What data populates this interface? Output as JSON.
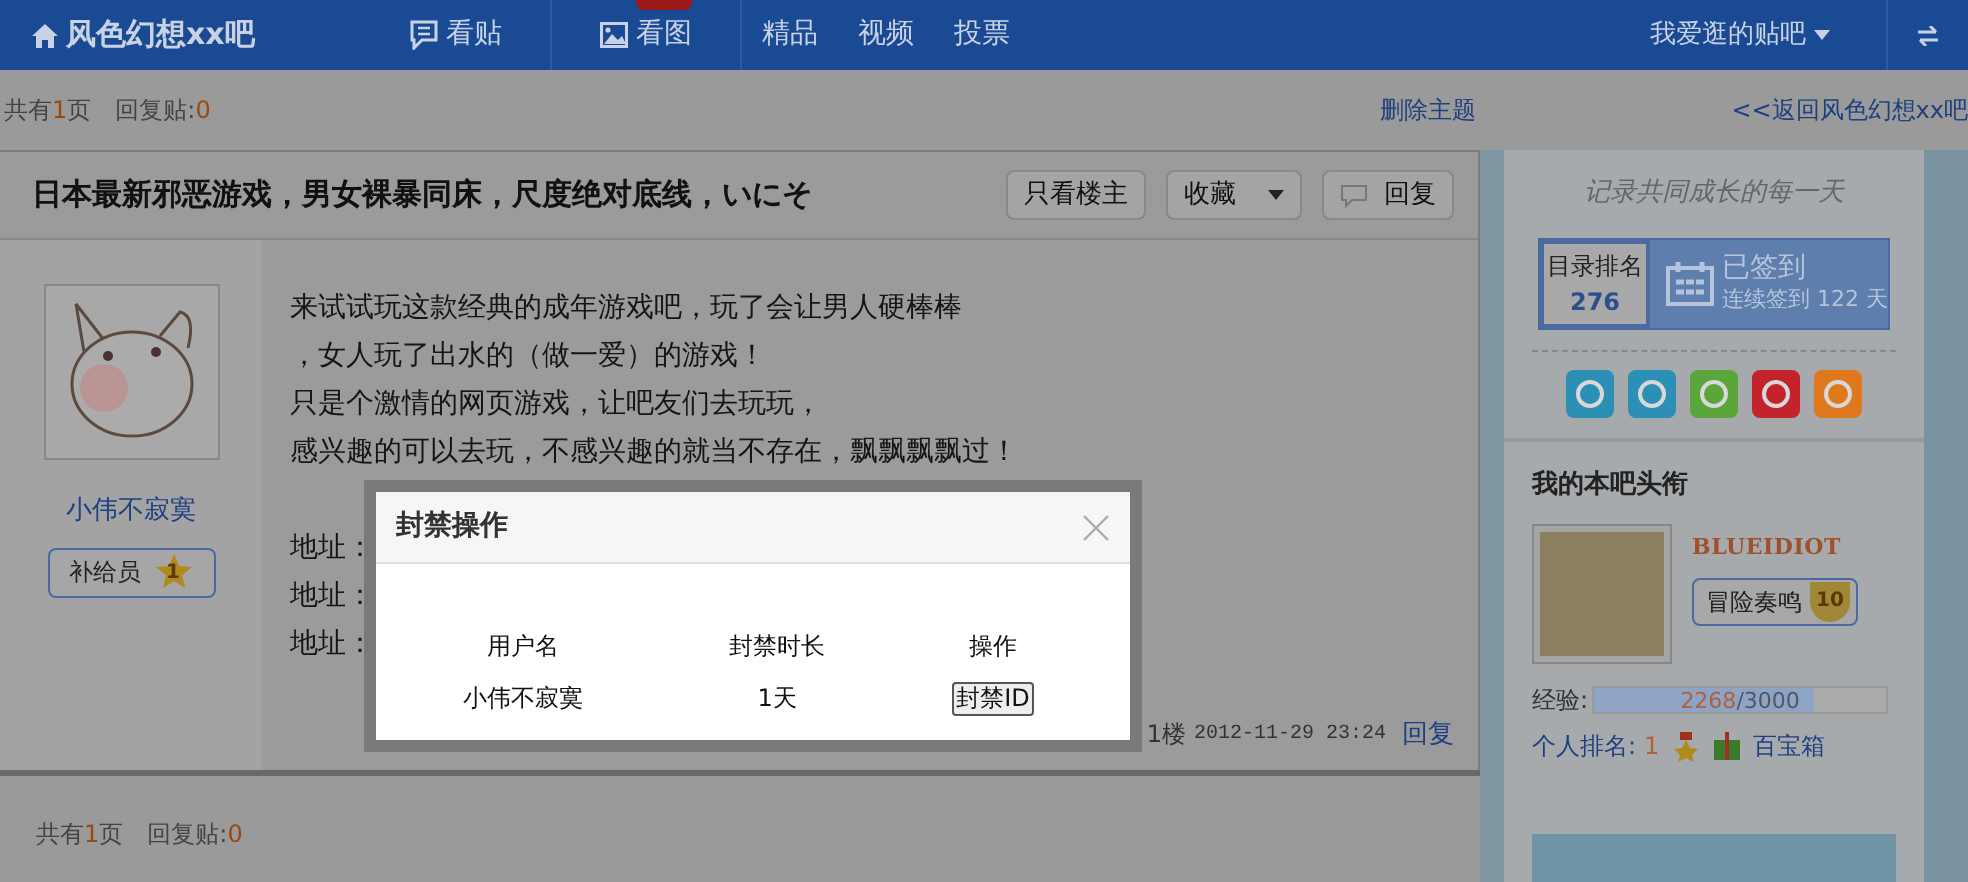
{
  "header": {
    "forum_name": "风色幻想xx吧",
    "nav": [
      {
        "label": "看贴",
        "kind": "post",
        "new_badge": false
      },
      {
        "label": "看图",
        "kind": "picture",
        "new_badge": true
      },
      {
        "label": "精品",
        "kind": "plain",
        "new_badge": false
      },
      {
        "label": "视频",
        "kind": "plain",
        "new_badge": false
      },
      {
        "label": "投票",
        "kind": "plain",
        "new_badge": false
      }
    ],
    "my_forums": "我爱逛的贴吧"
  },
  "info_bar": {
    "pages_label": "共有",
    "pages": "1",
    "pages_unit": "页",
    "replies_label": "回复贴:",
    "replies": "0",
    "delete": "删除主题",
    "back": "<<返回风色幻想xx吧"
  },
  "thread": {
    "title": "日本最新邪恶游戏，男女裸暴同床，尺度绝对底线，いにそ",
    "buttons": [
      {
        "label": "只看楼主",
        "kind": "plain"
      },
      {
        "label": "收藏",
        "kind": "dropdown"
      },
      {
        "label": "回复",
        "kind": "reply"
      }
    ],
    "post": {
      "author": "小伟不寂寞",
      "badge": "补给员",
      "badge_level": "1",
      "lines": [
        "来试试玩这款经典的成年游戏吧，玩了会让男人硬棒棒",
        "，女人玩了出水的（做一爱）的游戏！",
        "只是个激情的网页游戏，让吧友们去玩玩，",
        "感兴趣的可以去玩，不感兴趣的就当不存在，飘飘飘飘过！"
      ],
      "addresses": [
        "地址：",
        "地址：",
        "地址："
      ],
      "floor": "1楼",
      "time": "2012-11-29 23:24",
      "reply": "回复"
    }
  },
  "footer": {
    "pages_label": "共有",
    "pages": "1",
    "pages_unit": "页",
    "replies_label": "回复贴:",
    "replies": "0"
  },
  "sidebar": {
    "slogan": "记录共同成长的每一天",
    "rank_label": "目录排名",
    "rank": "276",
    "sign_status": "已签到",
    "sign_streak": "连续签到 122 天",
    "tools": [
      {
        "color": "#2b8fb6"
      },
      {
        "color": "#2b8fb6"
      },
      {
        "color": "#5aa63a"
      },
      {
        "color": "#c4232b"
      },
      {
        "color": "#e0781e"
      }
    ],
    "title_heading": "我的本吧头衔",
    "username": "BLUEIDIOT",
    "title_badge": "冒险奏鸣",
    "title_level": "10",
    "exp_label": "经验:",
    "exp": "2268",
    "exp_total": "/3000",
    "level": 0.756,
    "personal_rank_label": "个人排名:",
    "personal_rank": "1",
    "treasure": "百宝箱"
  },
  "modal": {
    "title": "封禁操作",
    "columns": [
      "用户名",
      "封禁时长",
      "操作"
    ],
    "row": [
      "小伟不寂寞",
      "1天"
    ],
    "action": "封禁ID"
  }
}
